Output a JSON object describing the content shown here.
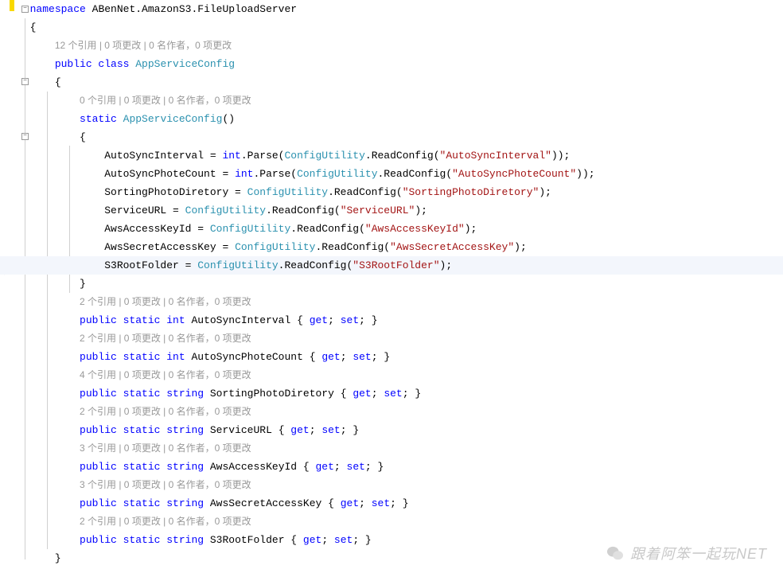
{
  "ns": {
    "kw": "namespace",
    "name": "ABenNet.AmazonS3.FileUploadServer"
  },
  "lens": {
    "class": "12 个引用 | 0 项更改 | 0 名作者，0 项更改",
    "ctor": "0 个引用 | 0 项更改 | 0 名作者，0 项更改",
    "p1": "2 个引用 | 0 项更改 | 0 名作者，0 项更改",
    "p2": "2 个引用 | 0 项更改 | 0 名作者，0 项更改",
    "p3": "4 个引用 | 0 项更改 | 0 名作者，0 项更改",
    "p4": "2 个引用 | 0 项更改 | 0 名作者，0 项更改",
    "p5": "3 个引用 | 0 项更改 | 0 名作者，0 项更改",
    "p6": "3 个引用 | 0 项更改 | 0 名作者，0 项更改",
    "p7": "2 个引用 | 0 项更改 | 0 名作者，0 项更改"
  },
  "cls": {
    "mods": "public class",
    "name": "AppServiceConfig"
  },
  "ctor": {
    "mod": "static",
    "name": "AppServiceConfig"
  },
  "body": {
    "l1": {
      "prop": "AutoSyncInterval",
      "eq": " = ",
      "t": "int",
      "m": ".Parse(",
      "u": "ConfigUtility",
      "r": ".ReadConfig(",
      "s": "\"AutoSyncInterval\"",
      "end": "));"
    },
    "l2": {
      "prop": "AutoSyncPhoteCount",
      "eq": " = ",
      "t": "int",
      "m": ".Parse(",
      "u": "ConfigUtility",
      "r": ".ReadConfig(",
      "s": "\"AutoSyncPhoteCount\"",
      "end": "));"
    },
    "l3": {
      "prop": "SortingPhotoDiretory",
      "eq": " = ",
      "u": "ConfigUtility",
      "r": ".ReadConfig(",
      "s": "\"SortingPhotoDiretory\"",
      "end": ");"
    },
    "l4": {
      "prop": "ServiceURL",
      "eq": " = ",
      "u": "ConfigUtility",
      "r": ".ReadConfig(",
      "s": "\"ServiceURL\"",
      "end": ");"
    },
    "l5": {
      "prop": "AwsAccessKeyId",
      "eq": " = ",
      "u": "ConfigUtility",
      "r": ".ReadConfig(",
      "s": "\"AwsAccessKeyId\"",
      "end": ");"
    },
    "l6": {
      "prop": "AwsSecretAccessKey",
      "eq": " = ",
      "u": "ConfigUtility",
      "r": ".ReadConfig(",
      "s": "\"AwsSecretAccessKey\"",
      "end": ");"
    },
    "l7": {
      "prop": "S3RootFolder",
      "eq": " = ",
      "u": "ConfigUtility",
      "r": ".ReadConfig(",
      "s": "\"S3RootFolder\"",
      "end": ");"
    }
  },
  "props": {
    "mods": "public static",
    "p1": {
      "t": "int",
      "n": "AutoSyncInterval"
    },
    "p2": {
      "t": "int",
      "n": "AutoSyncPhoteCount"
    },
    "p3": {
      "t": "string",
      "n": "SortingPhotoDiretory"
    },
    "p4": {
      "t": "string",
      "n": "ServiceURL"
    },
    "p5": {
      "t": "string",
      "n": "AwsAccessKeyId"
    },
    "p6": {
      "t": "string",
      "n": "AwsSecretAccessKey"
    },
    "p7": {
      "t": "string",
      "n": "S3RootFolder"
    }
  },
  "acc": {
    "open": " { ",
    "get": "get",
    "sep": "; ",
    "set": "set",
    "close": "; }"
  },
  "sym": {
    "obr": "{",
    "cbr": "}",
    "paren": "()"
  },
  "watermark": "跟着阿笨一起玩NET"
}
